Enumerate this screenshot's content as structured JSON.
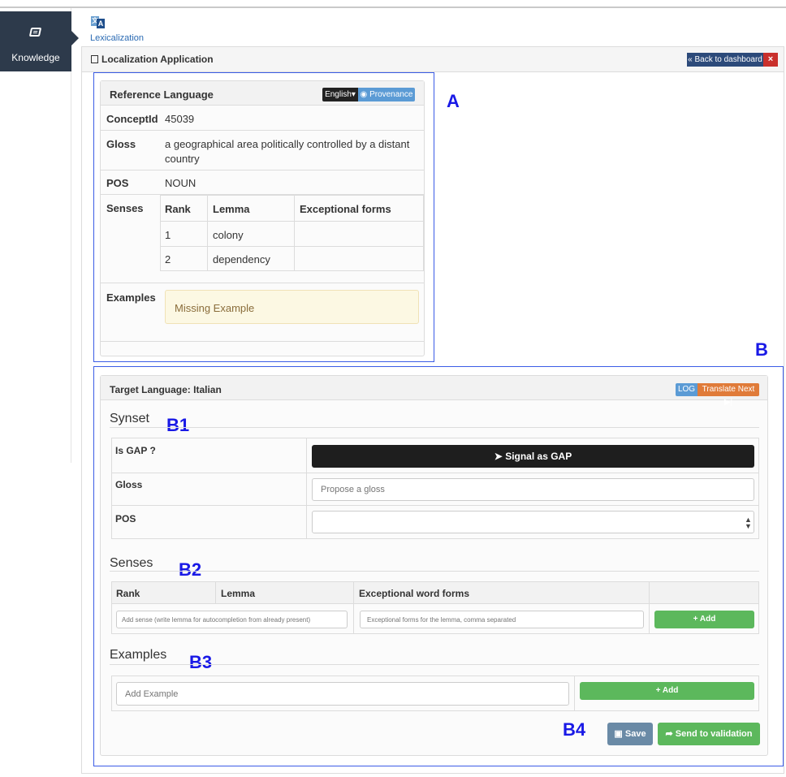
{
  "sidebar": {
    "nav_label": "Knowledge",
    "icon": "book-icon"
  },
  "breadcrumb": {
    "label": "Lexicalization",
    "icon": "translate-icon"
  },
  "header": {
    "title": "Localization Application",
    "back_button": "« Back to dashboard",
    "close_button": "×"
  },
  "reference": {
    "title": "Reference Language",
    "language_button": "English▾",
    "provenance_button": "Provenance",
    "concept_label": "ConceptId",
    "concept_value": "45039",
    "gloss_label": "Gloss",
    "gloss_line1": "a geographical area politically controlled by a distant",
    "gloss_line2": "country",
    "pos_label": "POS",
    "pos_value": "NOUN",
    "senses_label": "Senses",
    "senses_headers": [
      "Rank",
      "Lemma",
      "Exceptional forms"
    ],
    "senses_rows": [
      {
        "rank": "1",
        "lemma": "colony",
        "exceptional": ""
      },
      {
        "rank": "2",
        "lemma": "dependency",
        "exceptional": ""
      }
    ],
    "examples_label": "Examples",
    "missing_example": "Missing Example"
  },
  "target": {
    "title": "Target Language: Italian",
    "log_button": "LOG",
    "translate_next_button": "Translate Next ▶|",
    "synset_heading": "Synset",
    "gap_label": "Is GAP ?",
    "gap_button": "Signal as GAP",
    "gloss_label": "Gloss",
    "gloss_placeholder": "Propose a gloss",
    "pos_label": "POS",
    "senses_heading": "Senses",
    "senses_headers": [
      "Rank",
      "Lemma",
      "Exceptional word forms"
    ],
    "sense_placeholder": "Add sense (write lemma for autocompletion from already present)",
    "exceptional_placeholder": "Exceptional forms for the lemma, comma separated",
    "add_sense_button": "+ Add",
    "examples_heading": "Examples",
    "example_placeholder": "Add Example",
    "add_example_button": "+ Add",
    "save_button": "Save",
    "send_button": "Send to validation"
  },
  "annotations": {
    "a": "A",
    "b": "B",
    "b1": "B1",
    "b2": "B2",
    "b3": "B3",
    "b4": "B4"
  },
  "colors": {
    "annotation_blue": "#1919e6",
    "sidebar_dark": "#2d3a4b",
    "green_button": "#5cb85c",
    "back_button": "#2c4a7a"
  }
}
